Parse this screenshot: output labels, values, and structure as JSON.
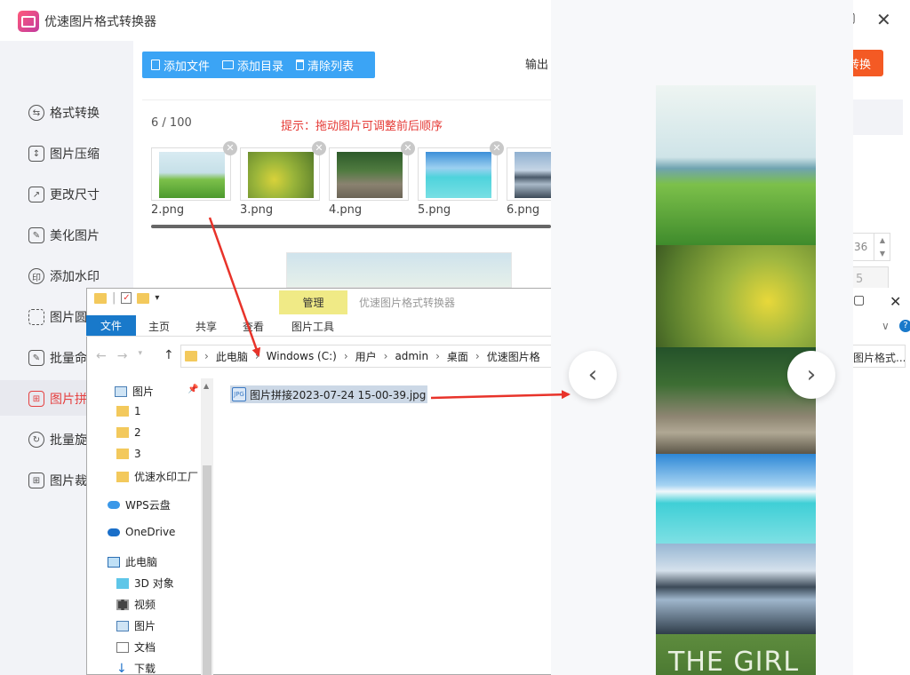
{
  "app": {
    "title": "优速图片格式转换器",
    "close_glyph": "✕",
    "restore_glyph": "▢"
  },
  "sidebar": {
    "items": [
      {
        "label": "格式转换",
        "icon": "swap-icon",
        "glyph": "⇆"
      },
      {
        "label": "图片压缩",
        "icon": "compress-icon",
        "glyph": "↕"
      },
      {
        "label": "更改尺寸",
        "icon": "resize-icon",
        "glyph": "↗"
      },
      {
        "label": "美化图片",
        "icon": "image-edit-icon",
        "glyph": "✎"
      },
      {
        "label": "添加水印",
        "icon": "watermark-icon",
        "glyph": "印"
      },
      {
        "label": "图片圆",
        "icon": "round-corner-icon",
        "glyph": ""
      },
      {
        "label": "批量命",
        "icon": "rename-icon",
        "glyph": "✎"
      },
      {
        "label": "图片拼",
        "icon": "stitch-icon",
        "glyph": "⊞"
      },
      {
        "label": "批量旋",
        "icon": "rotate-icon",
        "glyph": "↻"
      },
      {
        "label": "图片裁",
        "icon": "crop-icon",
        "glyph": "⊞"
      }
    ]
  },
  "toolbar": {
    "add_file": "添加文件",
    "add_folder": "添加目录",
    "clear_list": "清除列表",
    "output_label": "输出",
    "start_label": "转换"
  },
  "list": {
    "count": "6",
    "max": "/ 100",
    "hint": "提示：拖动图片可调整前后顺序",
    "thumbnails": [
      {
        "name": "2.png",
        "scene": "meadow"
      },
      {
        "name": "3.png",
        "scene": "flowers"
      },
      {
        "name": "4.png",
        "scene": "river"
      },
      {
        "name": "5.png",
        "scene": "beach"
      },
      {
        "name": "6.png",
        "scene": "lake"
      }
    ],
    "remove_glyph": "✕"
  },
  "settings": {
    "spin_value": "36",
    "spin2_value": "5"
  },
  "explorer": {
    "manage_tab": "管理",
    "title": "优速图片格式转换器",
    "tabs": {
      "file": "文件",
      "home": "主页",
      "share": "共享",
      "view": "查看",
      "picture_tools": "图片工具"
    },
    "breadcrumb": [
      "此电脑",
      "Windows (C:)",
      "用户",
      "admin",
      "桌面",
      "优速图片格"
    ],
    "search_text": "图片格式...",
    "help_glyph": "?",
    "tree": [
      {
        "label": "图片",
        "icon": "pictures-icon"
      },
      {
        "label": "1",
        "icon": "folder-icon"
      },
      {
        "label": "2",
        "icon": "folder-icon"
      },
      {
        "label": "3",
        "icon": "folder-icon"
      },
      {
        "label": "优速水印工厂",
        "icon": "folder-icon"
      },
      {
        "label": "WPS云盘",
        "icon": "cloud-icon"
      },
      {
        "label": "OneDrive",
        "icon": "onedrive-icon"
      },
      {
        "label": "此电脑",
        "icon": "computer-icon"
      },
      {
        "label": "3D 对象",
        "icon": "cube-icon"
      },
      {
        "label": "视频",
        "icon": "video-icon"
      },
      {
        "label": "图片",
        "icon": "pictures-icon"
      },
      {
        "label": "文档",
        "icon": "document-icon"
      },
      {
        "label": "下载",
        "icon": "download-icon"
      }
    ],
    "file_name": "图片拼接2023-07-24 15-00-39.jpg",
    "file_icon_text": "JPG"
  },
  "preview": {
    "prev_glyph": "‹",
    "next_glyph": "›",
    "overlay_text": "THE GIRL"
  },
  "colors": {
    "accent_blue": "#3ba4f5",
    "accent_orange": "#f45a24",
    "hint_red": "#e53935",
    "arrow_red": "#e8332a"
  }
}
